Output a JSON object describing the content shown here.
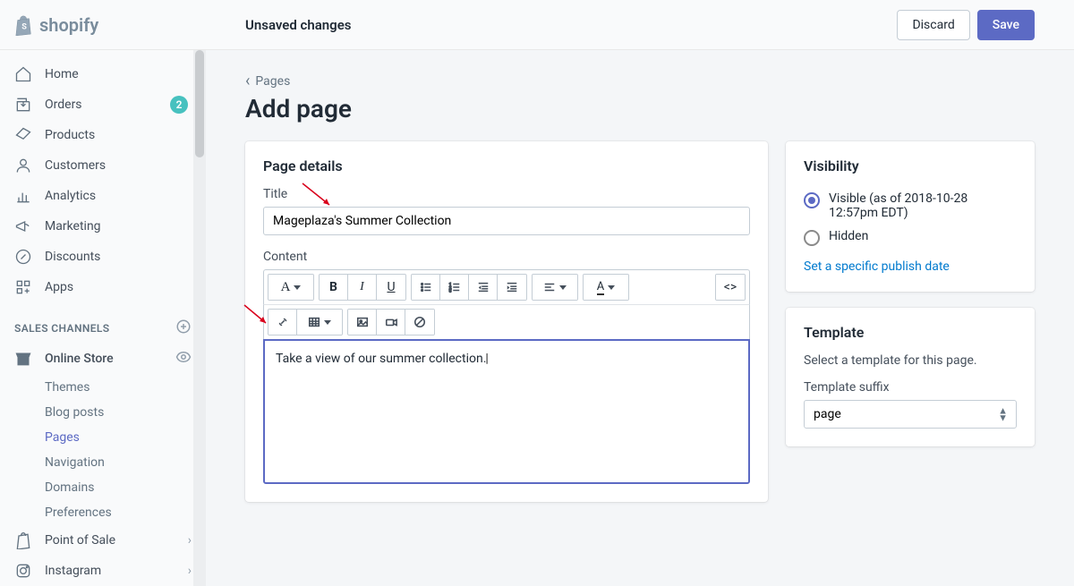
{
  "brand": "shopify",
  "header": {
    "status": "Unsaved changes",
    "discard": "Discard",
    "save": "Save"
  },
  "nav": {
    "home": "Home",
    "orders": "Orders",
    "orders_badge": "2",
    "products": "Products",
    "customers": "Customers",
    "analytics": "Analytics",
    "marketing": "Marketing",
    "discounts": "Discounts",
    "apps": "Apps",
    "section_channels": "SALES CHANNELS",
    "online_store": "Online Store",
    "sub": {
      "themes": "Themes",
      "blog_posts": "Blog posts",
      "pages": "Pages",
      "navigation": "Navigation",
      "domains": "Domains",
      "preferences": "Preferences"
    },
    "pos": "Point of Sale",
    "instagram": "Instagram"
  },
  "breadcrumb": "Pages",
  "page_title": "Add page",
  "details": {
    "card_title": "Page details",
    "title_label": "Title",
    "title_value": "Mageplaza's Summer Collection",
    "content_label": "Content",
    "editor_text": "Take a view of our summer collection.",
    "toolbar_html": "<>",
    "font_a": "A"
  },
  "visibility": {
    "card_title": "Visibility",
    "visible_label": "Visible (as of 2018-10-28 12:57pm EDT)",
    "hidden_label": "Hidden",
    "link": "Set a specific publish date"
  },
  "template": {
    "card_title": "Template",
    "helper": "Select a template for this page.",
    "suffix_label": "Template suffix",
    "value": "page"
  }
}
